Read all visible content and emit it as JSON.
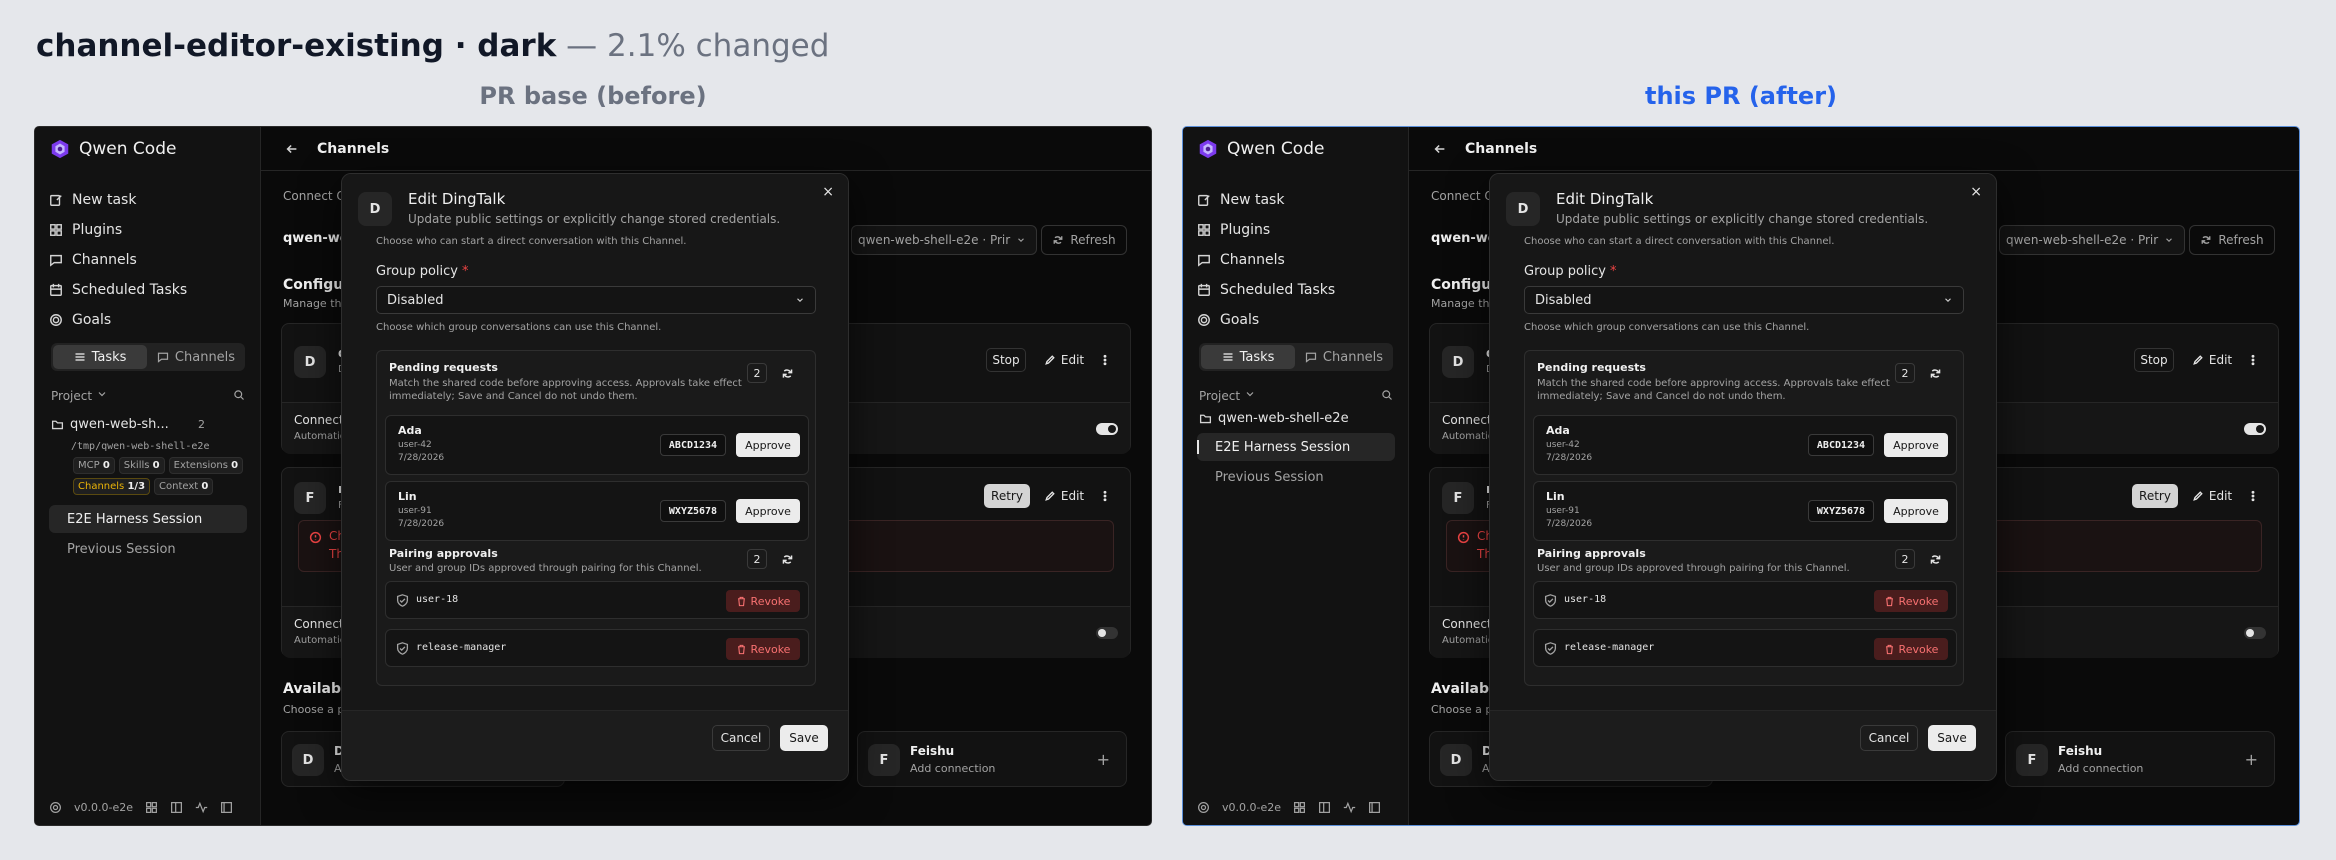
{
  "header": {
    "title_bold": "channel-editor-existing · dark",
    "title_rest": "— 2.1% changed"
  },
  "panels": {
    "before_label": "PR base (before)",
    "after_label": "this PR (after)"
  },
  "app": {
    "brand": "Qwen Code",
    "nav": [
      "New task",
      "Plugins",
      "Channels",
      "Scheduled Tasks",
      "Goals"
    ],
    "seg_tasks": "Tasks",
    "seg_channels": "Channels",
    "project_label": "Project",
    "workspace_before": "qwen-web-sh...",
    "workspace_after": "qwen-web-shell-e2e",
    "workspace_count": "2",
    "workspace_path": "/tmp/qwen-web-shell-e2e",
    "chips": {
      "mcp_label": "MCP",
      "mcp_count": "0",
      "skills_label": "Skills",
      "skills_count": "0",
      "ext_label": "Extensions",
      "ext_count": "0",
      "channels_label": "Channels",
      "channels_count": "1/3",
      "context_label": "Context",
      "context_count": "0"
    },
    "session_active": "E2E Harness Session",
    "session_prev": "Previous Session",
    "version": "v0.0.0-e2e"
  },
  "main": {
    "page_title": "Channels",
    "connect_text": "Connect Q",
    "workspace_name": "qwen-web",
    "workspace_select": "qwen-web-shell-e2e · Prir",
    "refresh_label": "Refresh",
    "config_title": "Configur",
    "config_desc": "Manage the",
    "card1_avatar": "D",
    "card1_name": "d",
    "card1_sub": "D",
    "card1_stop": "Stop",
    "card1_edit": "Edit",
    "card1_connect": "Connect",
    "card1_auto": "Automatio",
    "card2_avatar": "F",
    "card2_name": "r",
    "card2_sub": "F",
    "card2_retry": "Retry",
    "card2_edit": "Edit",
    "card2_err1": "Ch",
    "card2_err2": "The",
    "card2_connect": "Connect",
    "card2_auto": "Automatio",
    "avail_title": "Available",
    "avail_desc": "Choose a p",
    "avail1_avatar": "D",
    "avail1_name": "D",
    "avail1_desc": "A",
    "avail2_avatar": "F",
    "avail2_name": "Feishu",
    "avail2_desc": "Add connection",
    "avail_plus": "+"
  },
  "modal": {
    "avatar": "D",
    "title": "Edit DingTalk",
    "subtitle": "Update public settings or explicitly change stored credentials.",
    "close": "×",
    "cut_text": "Choose who can start a direct conversation with this Channel.",
    "group_label": "Group policy",
    "required_mark": "*",
    "group_value": "Disabled",
    "group_help": "Choose which group conversations can use this Channel.",
    "pending_title": "Pending requests",
    "pending_desc": "Match the shared code before approving access. Approvals take effect immediately; Save and Cancel do not undo them.",
    "pending_count": "2",
    "requests": [
      {
        "name": "Ada",
        "user": "user-42",
        "date": "7/28/2026",
        "code": "ABCD1234",
        "action": "Approve"
      },
      {
        "name": "Lin",
        "user": "user-91",
        "date": "7/28/2026",
        "code": "WXYZ5678",
        "action": "Approve"
      }
    ],
    "pairing_title": "Pairing approvals",
    "pairing_desc": "User and group IDs approved through pairing for this Channel.",
    "pairing_count": "2",
    "pairings": [
      {
        "id": "user-18",
        "action": "Revoke"
      },
      {
        "id": "release-manager",
        "action": "Revoke"
      }
    ],
    "cancel": "Cancel",
    "save": "Save"
  }
}
